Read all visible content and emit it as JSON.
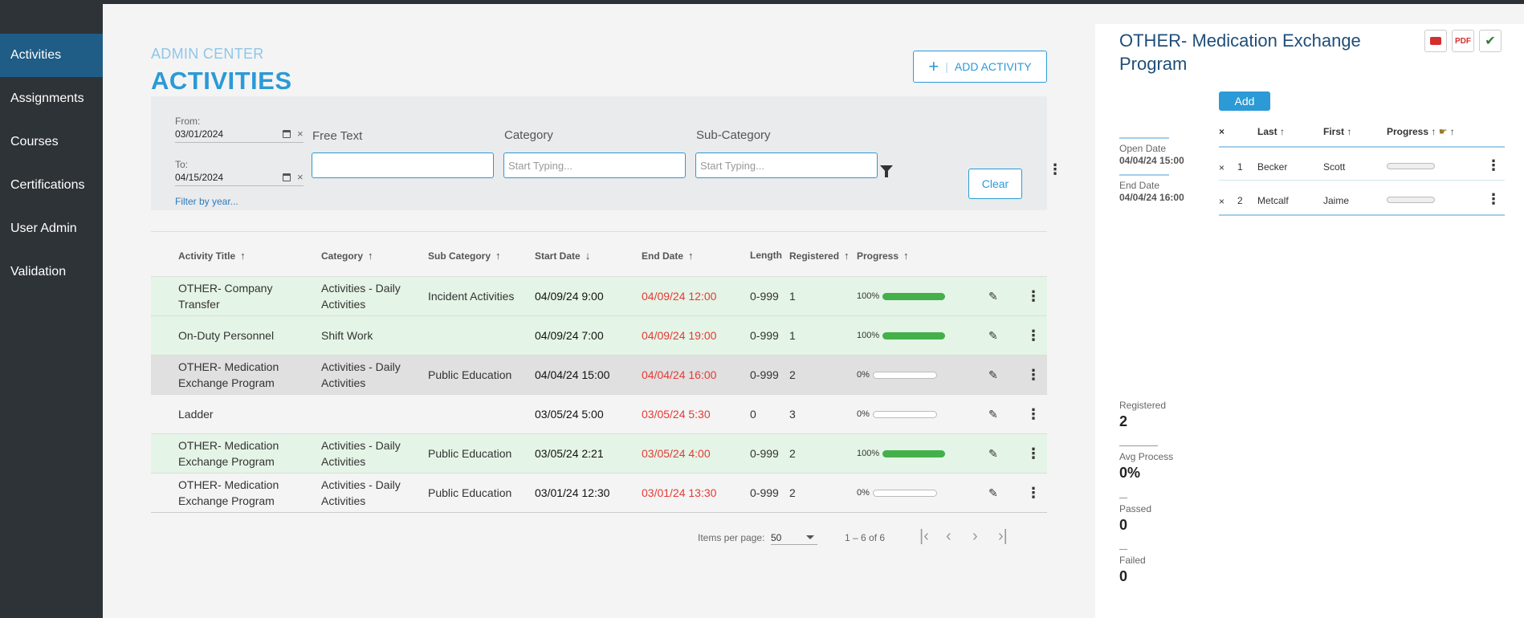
{
  "sidebar": {
    "items": [
      {
        "label": "Activities",
        "active": true
      },
      {
        "label": "Assignments"
      },
      {
        "label": "Courses"
      },
      {
        "label": "Certifications"
      },
      {
        "label": "User Admin"
      },
      {
        "label": "Validation"
      }
    ]
  },
  "header": {
    "kicker": "ADMIN CENTER",
    "title": "ACTIVITIES",
    "add_button_label": "ADD ACTIVITY",
    "add_button_icon": "plus-icon"
  },
  "filters": {
    "from_label": "From:",
    "from_value": "03/01/2024",
    "to_label": "To:",
    "to_value": "04/15/2024",
    "filter_by_year": "Filter by year...",
    "free_text_label": "Free Text",
    "free_text_value": "",
    "category_label": "Category",
    "category_placeholder": "Start Typing...",
    "subcategory_label": "Sub-Category",
    "subcategory_placeholder": "Start Typing...",
    "clear_label": "Clear"
  },
  "table": {
    "columns": {
      "title": "Activity Title",
      "category": "Category",
      "sub_category": "Sub Category",
      "start_date": "Start Date",
      "end_date": "End Date",
      "length": "Length",
      "registered": "Registered",
      "progress": "Progress"
    },
    "rows": [
      {
        "title": "OTHER- Company Transfer",
        "category": "Activities - Daily Activities",
        "sub": "Incident Activities",
        "start": "04/09/24 9:00",
        "end": "04/09/24 12:00",
        "length": "0-999",
        "registered": "1",
        "progress_text": "100%",
        "progress": 1.0,
        "status": "green"
      },
      {
        "title": "On-Duty Personnel",
        "category": "Shift Work",
        "sub": "",
        "start": "04/09/24 7:00",
        "end": "04/09/24 19:00",
        "length": "0-999",
        "registered": "1",
        "progress_text": "100%",
        "progress": 1.0,
        "status": "green"
      },
      {
        "title": "OTHER- Medication Exchange Program",
        "category": "Activities - Daily Activities",
        "sub": "Public Education",
        "start": "04/04/24 15:00",
        "end": "04/04/24 16:00",
        "length": "0-999",
        "registered": "2",
        "progress_text": "0%",
        "progress": 0.0,
        "status": "gray"
      },
      {
        "title": "Ladder",
        "category": "",
        "sub": "",
        "start": "03/05/24 5:00",
        "end": "03/05/24 5:30",
        "length": "0",
        "registered": "3",
        "progress_text": "0%",
        "progress": 0.0,
        "status": "white"
      },
      {
        "title": "OTHER- Medication Exchange Program",
        "category": "Activities - Daily Activities",
        "sub": "Public Education",
        "start": "03/05/24 2:21",
        "end": "03/05/24 4:00",
        "length": "0-999",
        "registered": "2",
        "progress_text": "100%",
        "progress": 1.0,
        "status": "green"
      },
      {
        "title": "OTHER- Medication Exchange Program",
        "category": "Activities - Daily Activities",
        "sub": "Public Education",
        "start": "03/01/24 12:30",
        "end": "03/01/24 13:30",
        "length": "0-999",
        "registered": "2",
        "progress_text": "0%",
        "progress": 0.0,
        "status": "white"
      }
    ]
  },
  "pager": {
    "items_per_page_label": "Items per page:",
    "items_per_page": "50",
    "range": "1 – 6 of 6"
  },
  "detail": {
    "title": "OTHER- Medication Exchange Program",
    "add_label": "Add",
    "open_date_label": "Open Date",
    "open_date_value": "04/04/24 15:00",
    "end_date_label": "End Date",
    "end_date_value": "04/04/24 16:00",
    "columns": {
      "last": "Last",
      "first": "First",
      "progress": "Progress"
    },
    "registrants": [
      {
        "num": "1",
        "last": "Becker",
        "first": "Scott",
        "progress": 0.0
      },
      {
        "num": "2",
        "last": "Metcalf",
        "first": "Jaime",
        "progress": 0.0
      }
    ],
    "stats": {
      "registered_label": "Registered",
      "registered_value": "2",
      "avg_label": "Avg Process",
      "avg_value": "0%",
      "passed_label": "Passed",
      "passed_value": "0",
      "failed_label": "Failed",
      "failed_value": "0"
    },
    "icons": [
      "video-icon",
      "pdf-icon",
      "certificate-check-icon"
    ]
  },
  "colors": {
    "accent": "#2b9ad6",
    "sidebar": "#2e3338",
    "sidebar_active": "#1f5c86",
    "end_date": "#e53935",
    "progress_fill": "#43b04a"
  }
}
